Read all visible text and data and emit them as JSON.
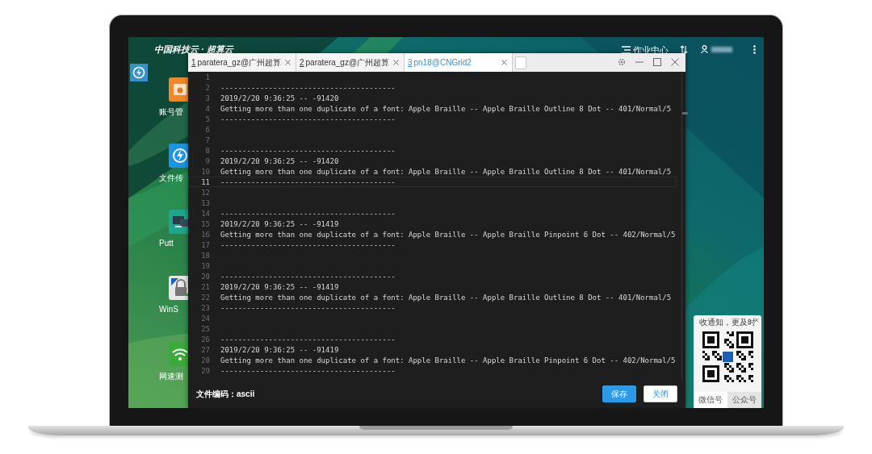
{
  "desktop": {
    "brand": "中国科技云 · 超算云",
    "job_center": "作业中心",
    "icons": [
      {
        "kind": "folder",
        "label": "账号管"
      },
      {
        "kind": "transfer",
        "label": "文件传"
      },
      {
        "kind": "terminal",
        "label": "Putt"
      },
      {
        "kind": "lock",
        "label": "WinS"
      },
      {
        "kind": "wifi",
        "label": "网速测"
      }
    ]
  },
  "editor": {
    "tabs": [
      {
        "number": "1",
        "label": "paratera_gz@广州超算",
        "selected": false
      },
      {
        "number": "2",
        "label": "paratera_gz@广州超算",
        "selected": false
      },
      {
        "number": "3",
        "label": "pn18@CNGrid2",
        "selected": true
      }
    ],
    "lines": [
      {
        "number": "1",
        "current": false
      },
      {
        "number": "2",
        "text": "----------------------------------------",
        "current": false
      },
      {
        "number": "3",
        "text": "2019/2/20 9:36:25 -- -91420",
        "current": false
      },
      {
        "number": "4",
        "text": "Getting more than one duplicate of a font: Apple Braille -- Apple Braille Outline 8 Dot -- 401/Normal/5",
        "current": false
      },
      {
        "number": "5",
        "text": "----------------------------------------",
        "current": false
      },
      {
        "number": "6",
        "current": false
      },
      {
        "number": "7",
        "current": false
      },
      {
        "number": "8",
        "text": "----------------------------------------",
        "current": false
      },
      {
        "number": "9",
        "text": "2019/2/20 9:36:25 -- -91420",
        "current": false
      },
      {
        "number": "10",
        "text": "Getting more than one duplicate of a font: Apple Braille -- Apple Braille Outline 8 Dot -- 401/Normal/5",
        "current": false
      },
      {
        "number": "11",
        "text": "----------------------------------------",
        "current": true
      },
      {
        "number": "12",
        "current": false
      },
      {
        "number": "13",
        "current": false
      },
      {
        "number": "14",
        "text": "----------------------------------------",
        "current": false
      },
      {
        "number": "15",
        "text": "2019/2/20 9:36:25 -- -91419",
        "current": false
      },
      {
        "number": "16",
        "text": "Getting more than one duplicate of a font: Apple Braille -- Apple Braille Pinpoint 6 Dot -- 402/Normal/5",
        "current": false
      },
      {
        "number": "17",
        "text": "----------------------------------------",
        "current": false
      },
      {
        "number": "18",
        "current": false
      },
      {
        "number": "19",
        "current": false
      },
      {
        "number": "20",
        "text": "----------------------------------------",
        "current": false
      },
      {
        "number": "21",
        "text": "2019/2/20 9:36:25 -- -91419",
        "current": false
      },
      {
        "number": "22",
        "text": "Getting more than one duplicate of a font: Apple Braille -- Apple Braille Outline 8 Dot -- 401/Normal/5",
        "current": false
      },
      {
        "number": "23",
        "text": "----------------------------------------",
        "current": false
      },
      {
        "number": "24",
        "current": false
      },
      {
        "number": "25",
        "current": false
      },
      {
        "number": "26",
        "text": "----------------------------------------",
        "current": false
      },
      {
        "number": "27",
        "text": "2019/2/20 9:36:25 -- -91419",
        "current": false
      },
      {
        "number": "28",
        "text": "Getting more than one duplicate of a font: Apple Braille -- Apple Braille Pinpoint 6 Dot -- 402/Normal/5",
        "current": false
      },
      {
        "number": "29",
        "text": "----------------------------------------",
        "current": false
      }
    ],
    "encoding": "文件编码：ascii",
    "buttons": [
      {
        "kind": "primary",
        "label": "保存"
      },
      {
        "kind": "secondary",
        "label": "关闭"
      }
    ]
  },
  "qr_popup": {
    "title": "收通知，更及时",
    "tabs": [
      {
        "label": "微信号",
        "selected": true
      },
      {
        "label": "公众号",
        "selected": false
      }
    ]
  }
}
